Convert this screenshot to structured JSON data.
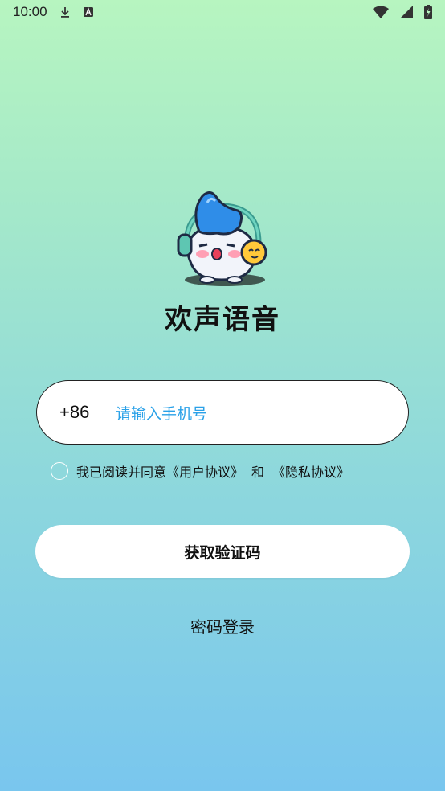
{
  "status_bar": {
    "time": "10:00",
    "icons": [
      "download-icon",
      "a-badge-icon",
      "wifi-icon",
      "signal-icon",
      "battery-charging-icon"
    ]
  },
  "app": {
    "title": "欢声语音",
    "logo": "mascot-with-headphones"
  },
  "login": {
    "country_code": "+86",
    "phone_placeholder": "请输入手机号",
    "phone_value": "",
    "agreement": {
      "prefix": "我已阅读并同意",
      "user_agreement": "《用户协议》",
      "and": "和",
      "privacy_agreement": "《隐私协议》",
      "checked": false
    },
    "get_code_label": "获取验证码",
    "password_login_label": "密码登录"
  },
  "colors": {
    "gradient_top": "#b7f5c0",
    "gradient_bottom": "#79c6ee",
    "placeholder": "#2aa1e8",
    "button_bg": "#ffffff"
  }
}
